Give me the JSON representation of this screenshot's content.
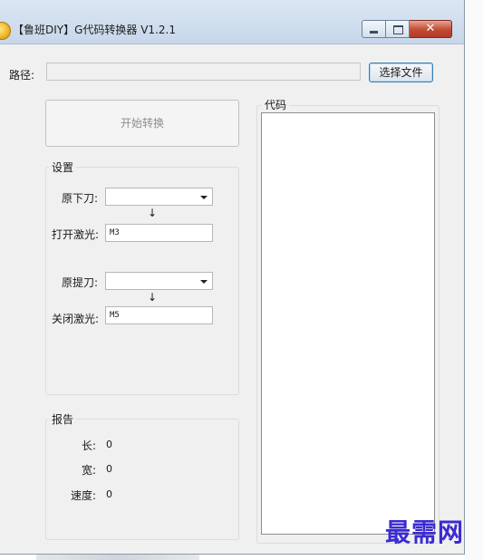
{
  "window": {
    "title": "【鲁班DIY】G代码转换器 V1.2.1",
    "close_glyph": "✕"
  },
  "path": {
    "label": "路径:",
    "value": "",
    "choose_button": "选择文件"
  },
  "start_button": "开始转换",
  "settings": {
    "label": "设置",
    "original_down_label": "原下刀:",
    "original_down_value": "",
    "arrow": "↓",
    "laser_on_label": "打开激光:",
    "laser_on_value": "M3",
    "original_up_label": "原提刀:",
    "original_up_value": "",
    "laser_off_label": "关闭激光:",
    "laser_off_value": "M5"
  },
  "report": {
    "label": "报告",
    "length_label": "长:",
    "length_value": "0",
    "width_label": "宽:",
    "width_value": "0",
    "speed_label": "速度:",
    "speed_value": "0"
  },
  "code": {
    "label": "代码",
    "content": ""
  },
  "watermark": "最需网",
  "colors": {
    "window_bg": "#f0f0f0",
    "close_button": "#c24a33",
    "accent_border": "#3c7fb1",
    "watermark": "#3b2bd0"
  }
}
